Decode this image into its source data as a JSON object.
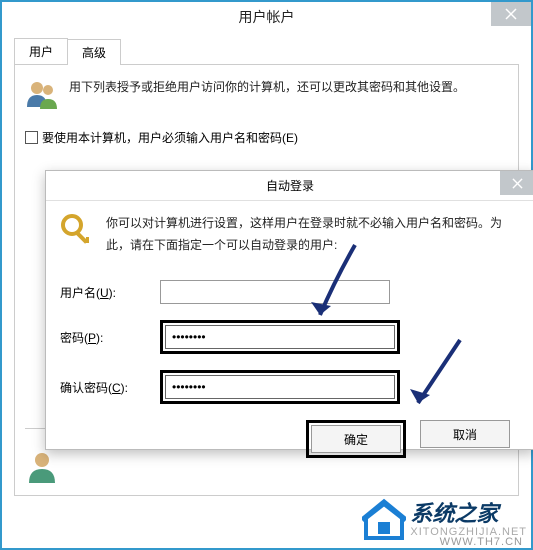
{
  "window1": {
    "title": "用户帐户",
    "tabs": [
      "用户",
      "高级"
    ],
    "desc": "用下列表授予或拒绝用户访问你的计算机，还可以更改其密码和其他设置。",
    "checkbox_label": "要使用本计算机，用户必须输入用户名和密码(E)"
  },
  "dialog": {
    "title": "自动登录",
    "desc": "你可以对计算机进行设置，这样用户在登录时就不必输入用户名和密码。为此，请在下面指定一个可以自动登录的用户:",
    "username_label": "用户名(U):",
    "username_value": "",
    "password_label": "密码(P):",
    "password_value": "••••••••",
    "confirm_label": "确认密码(C):",
    "confirm_value": "••••••••",
    "ok_label": "确定",
    "cancel_label": "取消"
  },
  "watermark": {
    "url": "WWW.TH7.CN",
    "brand": "系统之家",
    "sub": "XITONGZHIJIA.NET"
  }
}
